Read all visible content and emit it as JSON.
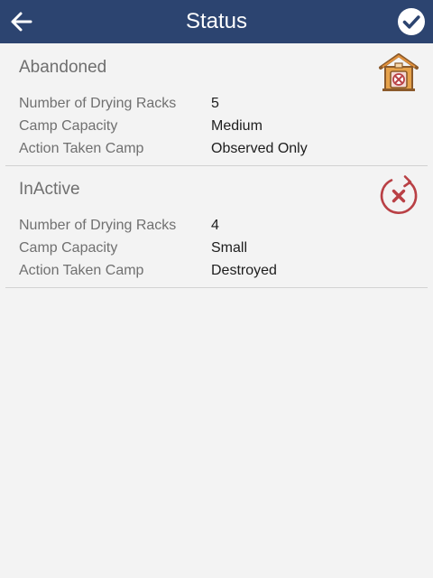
{
  "header": {
    "title": "Status",
    "back_icon": "arrow-left-icon",
    "confirm_icon": "check-circle-icon"
  },
  "records": [
    {
      "status": "Abandoned",
      "icon": "abandoned-house-icon",
      "fields": [
        {
          "label": "Number of Drying Racks",
          "value": "5"
        },
        {
          "label": "Camp Capacity",
          "value": "Medium"
        },
        {
          "label": "Action Taken Camp",
          "value": "Observed Only"
        }
      ]
    },
    {
      "status": "InActive",
      "icon": "inactive-refresh-x-icon",
      "fields": [
        {
          "label": "Number of Drying Racks",
          "value": "4"
        },
        {
          "label": "Camp Capacity",
          "value": "Small"
        },
        {
          "label": "Action Taken Camp",
          "value": "Destroyed"
        }
      ]
    }
  ],
  "colors": {
    "header_bg": "#2c4470",
    "page_bg": "#f3f3f3",
    "inactive_accent": "#b94045",
    "house_orange": "#e2913b"
  }
}
